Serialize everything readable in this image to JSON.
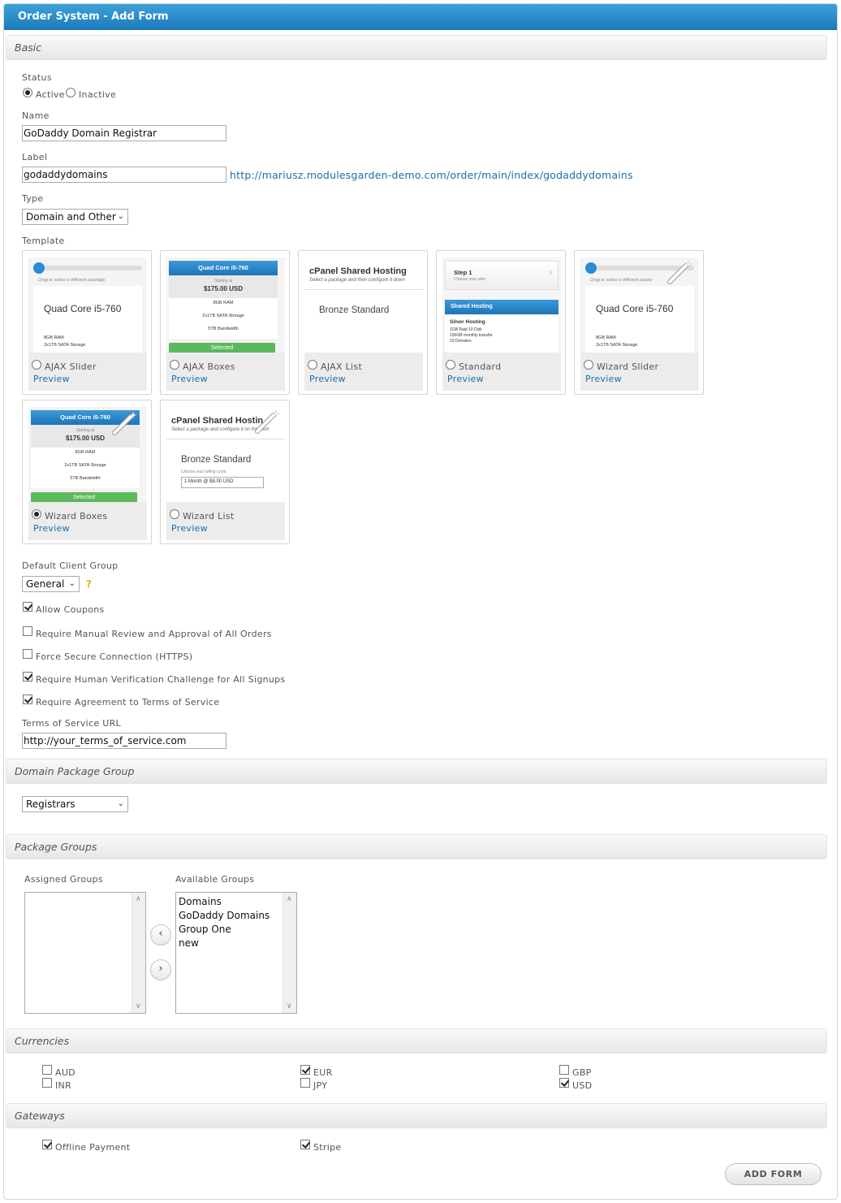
{
  "window": {
    "title": "Order System - Add Form"
  },
  "sections": {
    "basic": "Basic",
    "domain_package_group": "Domain Package Group",
    "package_groups": "Package Groups",
    "currencies": "Currencies",
    "gateways": "Gateways"
  },
  "status": {
    "label": "Status",
    "options": [
      {
        "label": "Active",
        "checked": true
      },
      {
        "label": "Inactive",
        "checked": false
      }
    ]
  },
  "name": {
    "label": "Name",
    "value": "GoDaddy Domain Registrar"
  },
  "form_label": {
    "label": "Label",
    "value": "godaddydomains",
    "url": "http://mariusz.modulesgarden-demo.com/order/main/index/godaddydomains"
  },
  "type": {
    "label": "Type",
    "value": "Domain and Other"
  },
  "template": {
    "label": "Template",
    "preview_label": "Preview",
    "items": [
      {
        "name": "AJAX Slider",
        "selected": false
      },
      {
        "name": "AJAX Boxes",
        "selected": false
      },
      {
        "name": "AJAX List",
        "selected": false
      },
      {
        "name": "Standard",
        "selected": false
      },
      {
        "name": "Wizard Slider",
        "selected": false
      },
      {
        "name": "Wizard Boxes",
        "selected": true
      },
      {
        "name": "Wizard List",
        "selected": false
      }
    ],
    "thumbs": {
      "slider_hint": "Drag to select a different package.",
      "slider_hint_short": "Drag to select a different packa",
      "plan": "Quad Core i5-760",
      "starting_at": "Starting at",
      "price": "$175.00 USD",
      "ram": "8GB RAM",
      "storage": "2x1TB SATA Storage",
      "bandwidth": "5TB Bandwidth",
      "selected": "Selected",
      "list_title": "cPanel Shared Hosting",
      "list_title_cut": "cPanel Shared Hostin",
      "list_sub": "Select a package and then configure it down",
      "list_sub2": "Select a package and configure it on the next",
      "bronze": "Bronze Standard",
      "billing_hint": "Choose your billing cycle.",
      "billing_value": "1 Month @ $8.00 USD",
      "step": "Step 1",
      "choose_plan": "Choose your plan",
      "shared": "Shared Hosting",
      "silver": "Silver Hosting",
      "silver_lines": [
        "1GB Raid 10 Disk",
        "100GB monthly transfer",
        "10 Domains"
      ]
    }
  },
  "client_group": {
    "label": "Default Client Group",
    "value": "General",
    "help": "?"
  },
  "checks": [
    {
      "label": "Allow Coupons",
      "checked": true
    },
    {
      "label": "Require Manual Review and Approval of All Orders",
      "checked": false
    },
    {
      "label": "Force Secure Connection (HTTPS)",
      "checked": false
    },
    {
      "label": "Require Human Verification Challenge for All Signups",
      "checked": true
    },
    {
      "label": "Require Agreement to Terms of Service",
      "checked": true
    }
  ],
  "tos_url": {
    "label": "Terms of Service URL",
    "value": "http://your_terms_of_service.com"
  },
  "domain_group": {
    "value": "Registrars"
  },
  "package_groups": {
    "assigned_label": "Assigned Groups",
    "available_label": "Available Groups",
    "assigned": [],
    "available": [
      "Domains",
      "GoDaddy Domains",
      "Group One",
      "new"
    ]
  },
  "currencies": [
    {
      "code": "AUD",
      "checked": false
    },
    {
      "code": "EUR",
      "checked": true
    },
    {
      "code": "GBP",
      "checked": false
    },
    {
      "code": "INR",
      "checked": false
    },
    {
      "code": "JPY",
      "checked": false
    },
    {
      "code": "USD",
      "checked": true
    }
  ],
  "gateways": [
    {
      "name": "Offline Payment",
      "checked": true
    },
    {
      "name": "Stripe",
      "checked": true
    }
  ],
  "submit": {
    "label": "ADD FORM"
  },
  "colors": {
    "titlebar": "#1b79b9",
    "link": "#1a6fa9",
    "selected_green": "#5cb85c",
    "help": "#d5b800"
  },
  "icons": {
    "move_left": "chevron-left-icon",
    "move_right": "chevron-right-icon",
    "wizard": "magic-wand-icon"
  }
}
